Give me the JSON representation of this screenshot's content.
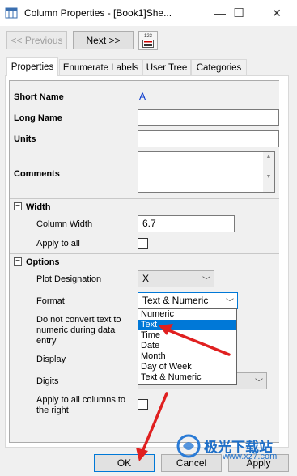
{
  "window": {
    "title": "Column Properties - [Book1]She...",
    "minimize_glyph": "—",
    "maximize_glyph": "☐",
    "close_glyph": "✕"
  },
  "toolbar": {
    "previous_label": "<< Previous",
    "next_label": "Next >>",
    "settings_icon_text": "123"
  },
  "tabs": [
    {
      "label": "Properties",
      "active": true
    },
    {
      "label": "Enumerate Labels",
      "active": false
    },
    {
      "label": "User Tree",
      "active": false
    },
    {
      "label": "Categories",
      "active": false
    }
  ],
  "fields": {
    "short_name_label": "Short Name",
    "short_name_value": "A",
    "long_name_label": "Long Name",
    "long_name_value": "",
    "units_label": "Units",
    "units_value": "",
    "comments_label": "Comments",
    "comments_value": ""
  },
  "width_section": {
    "label": "Width",
    "column_width_label": "Column Width",
    "column_width_value": "6.7",
    "apply_to_all_label": "Apply to all",
    "apply_to_all_checked": false
  },
  "options_section": {
    "label": "Options",
    "plot_designation_label": "Plot Designation",
    "plot_designation_value": "X",
    "format_label": "Format",
    "format_value": "Text & Numeric",
    "no_convert_label_1": "Do not convert text to",
    "no_convert_label_2": "numeric during data",
    "no_convert_label_3": "entry",
    "display_label": "Display",
    "digits_label": "Digits",
    "apply_all_right_label_1": "Apply to all columns to",
    "apply_all_right_label_2": "the right"
  },
  "format_dropdown": {
    "options": [
      "Numeric",
      "Text",
      "Time",
      "Date",
      "Month",
      "Day of Week",
      "Text & Numeric"
    ],
    "highlighted": "Text"
  },
  "buttons": {
    "ok": "OK",
    "cancel": "Cancel",
    "apply": "Apply"
  },
  "watermark": {
    "text": "极光下载站",
    "url": "www.xz7.com"
  },
  "colors": {
    "accent": "#0078d7",
    "annotation_arrow": "#e02020",
    "short_name_value": "#0033cc"
  }
}
